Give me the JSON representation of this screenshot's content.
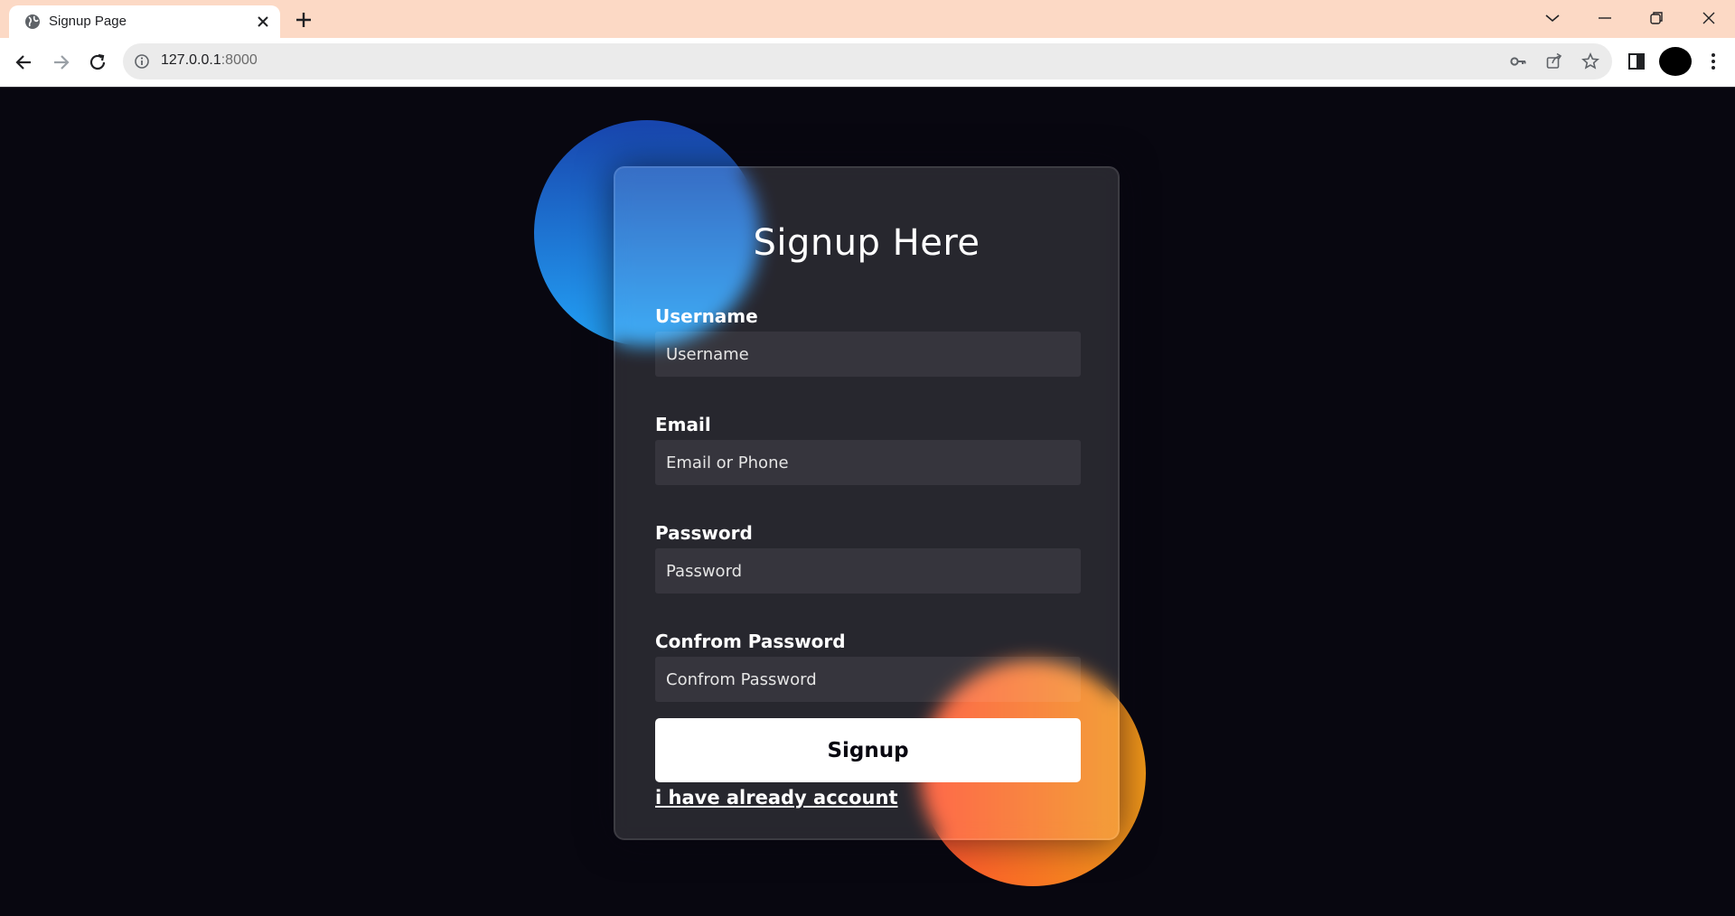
{
  "browser": {
    "tab": {
      "title": "Signup Page",
      "favicon": "globe-icon"
    },
    "address": {
      "host": "127.0.0.1",
      "port": ":8000"
    },
    "icons": {
      "back": "arrow-left-icon",
      "forward": "arrow-right-icon",
      "reload": "reload-icon",
      "new_tab": "plus-icon",
      "key": "key-icon",
      "share": "share-icon",
      "bookmark": "star-icon",
      "side_panel": "side-panel-icon",
      "menu": "kebab-menu-icon",
      "tab_search": "chevron-down-icon",
      "minimize": "minimize-icon",
      "restore": "restore-icon",
      "close": "close-icon"
    }
  },
  "form": {
    "title": "Signup Here",
    "fields": {
      "username": {
        "label": "Username",
        "placeholder": "Username",
        "value": ""
      },
      "email": {
        "label": "Email",
        "placeholder": "Email or Phone",
        "value": ""
      },
      "password": {
        "label": "Password",
        "placeholder": "Password",
        "value": ""
      },
      "confirm": {
        "label": "Confrom Password",
        "placeholder": "Confrom Password",
        "value": ""
      }
    },
    "submit_label": "Signup",
    "login_link": "i have already account"
  },
  "colors": {
    "page_background": "#080710",
    "blue_gradient": [
      "#1845ad",
      "#23a2f6"
    ],
    "orange_gradient": [
      "#ff512f",
      "#f09819"
    ],
    "tabbar": "#fcd9c5"
  }
}
